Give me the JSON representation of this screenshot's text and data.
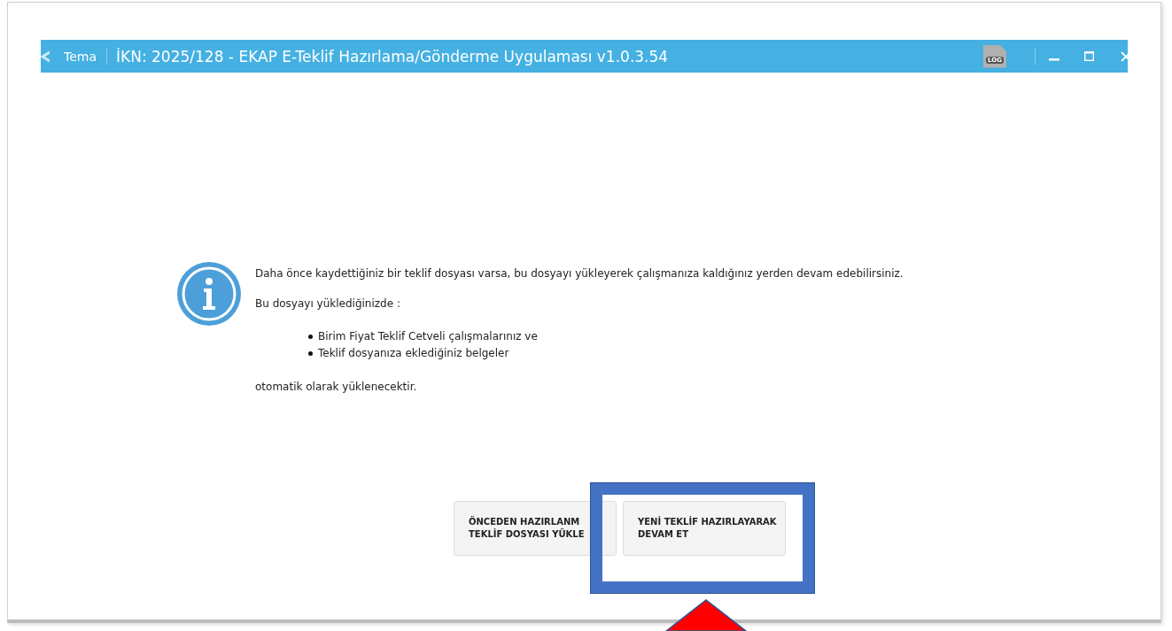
{
  "window": {
    "menu": "Tema",
    "title": "İKN: 2025/128 - EKAP E-Teklif Hazırlama/Gönderme Uygulaması v1.0.3.54",
    "log_label": "LOG"
  },
  "message": {
    "intro": "Daha önce kaydettiğiniz bir teklif dosyası varsa, bu dosyayı yükleyerek çalışmanıza kaldığınız yerden devam edebilirsiniz.",
    "lead": "Bu dosyayı yüklediğinizde :",
    "bullets": [
      "Birim Fiyat Teklif Cetveli çalışmalarınız ve",
      "Teklif dosyanıza eklediğiniz belgeler"
    ],
    "outro": "otomatik olarak yüklenecektir."
  },
  "buttons": [
    {
      "lines": [
        "ÖNCEDEN HAZIRLANM",
        "TEKLİF DOSYASI YÜKLE"
      ]
    },
    {
      "lines": [
        "YENİ TEKLİF HAZIRLAYARAK",
        "DEVAM ET"
      ]
    }
  ]
}
